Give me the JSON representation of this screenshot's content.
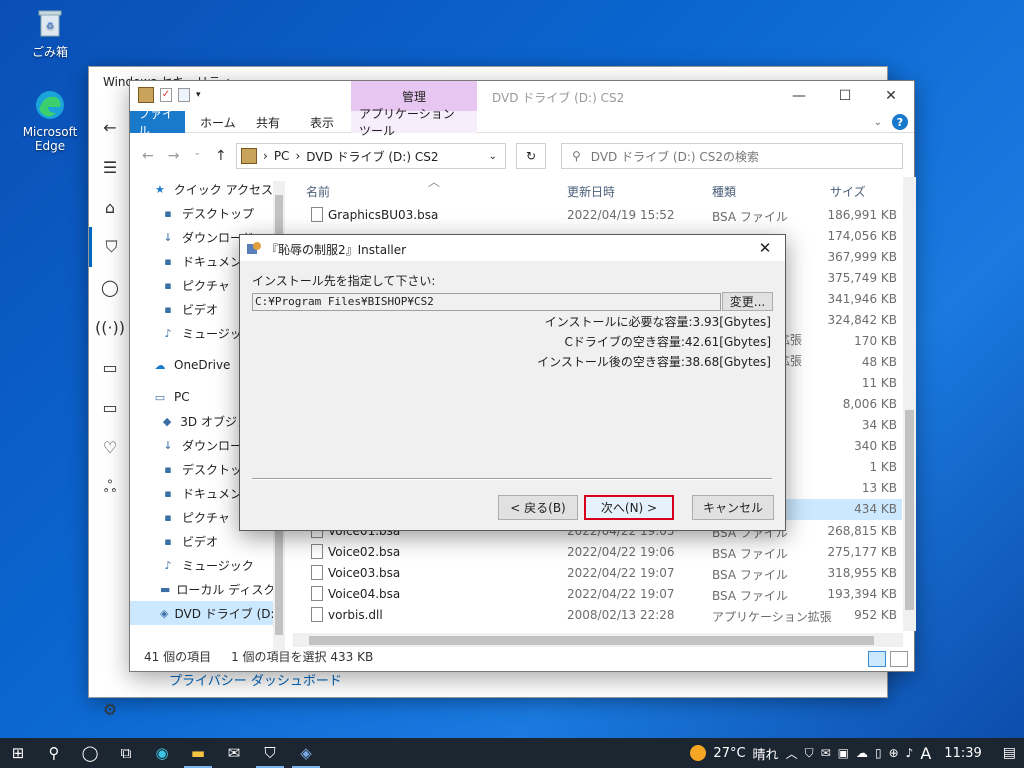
{
  "desktop": {
    "icons": [
      {
        "label": "ごみ箱"
      },
      {
        "label": "Microsoft Edge"
      }
    ]
  },
  "security_window": {
    "title": "Windows セキュリティ",
    "footer_link": "プライバシー ダッシュボード"
  },
  "explorer": {
    "manage_tab": "管理",
    "title": "DVD ドライブ (D:) CS2",
    "ribbon": {
      "file": "ファイル",
      "home": "ホーム",
      "share": "共有",
      "view": "表示",
      "app_tools": "アプリケーション ツール"
    },
    "address": {
      "crumb_pc": "PC",
      "crumb_drive": "DVD ドライブ (D:) CS2"
    },
    "search_placeholder": "DVD ドライブ (D:) CS2の検索",
    "nav": [
      {
        "label": "クイック アクセス",
        "icon": "star-icon",
        "indent": 22
      },
      {
        "label": "デスクトップ",
        "icon": "desktop-folder-icon",
        "indent": 30
      },
      {
        "label": "ダウンロード",
        "icon": "download-folder-icon",
        "indent": 30
      },
      {
        "label": "ドキュメント",
        "icon": "documents-folder-icon",
        "indent": 30
      },
      {
        "label": "ピクチャ",
        "icon": "pictures-folder-icon",
        "indent": 30
      },
      {
        "label": "ビデオ",
        "icon": "videos-folder-icon",
        "indent": 30
      },
      {
        "label": "ミュージック",
        "icon": "music-folder-icon",
        "indent": 30
      },
      {
        "label": "OneDrive",
        "icon": "onedrive-icon",
        "indent": 22
      },
      {
        "label": "PC",
        "icon": "pc-icon",
        "indent": 22
      },
      {
        "label": "3D オブジェクト",
        "icon": "3d-objects-icon",
        "indent": 30
      },
      {
        "label": "ダウンロード",
        "icon": "download-folder-icon",
        "indent": 30
      },
      {
        "label": "デスクトップ",
        "icon": "desktop-folder-icon",
        "indent": 30
      },
      {
        "label": "ドキュメント",
        "icon": "documents-folder-icon",
        "indent": 30
      },
      {
        "label": "ピクチャ",
        "icon": "pictures-folder-icon",
        "indent": 30
      },
      {
        "label": "ビデオ",
        "icon": "videos-folder-icon",
        "indent": 30
      },
      {
        "label": "ミュージック",
        "icon": "music-folder-icon",
        "indent": 30
      },
      {
        "label": "ローカル ディスク (C",
        "icon": "local-disk-icon",
        "indent": 30
      },
      {
        "label": "DVD ドライブ (D:)",
        "icon": "dvd-drive-icon",
        "indent": 30
      }
    ],
    "columns": {
      "name": "名前",
      "date": "更新日時",
      "type": "種類",
      "size": "サイズ"
    },
    "files_top": [
      {
        "name": "GraphicsBU03.bsa",
        "date": "2022/04/19 15:52",
        "type": "BSA ファイル",
        "size": "186,991 KB"
      }
    ],
    "size_column_visible": [
      "174,056 KB",
      "367,999 KB",
      "375,749 KB",
      "341,946 KB",
      "324,842 KB",
      "170 KB",
      "48 KB",
      "11 KB",
      "8,006 KB",
      "34 KB",
      "340 KB",
      "1 KB",
      "13 KB",
      "434 KB"
    ],
    "type_fragments": [
      "拡張",
      "拡張"
    ],
    "files_bottom": [
      {
        "name": "Voice01.bsa",
        "date": "2022/04/22 19:05",
        "type": "BSA ファイル",
        "size": "268,815 KB"
      },
      {
        "name": "Voice02.bsa",
        "date": "2022/04/22 19:06",
        "type": "BSA ファイル",
        "size": "275,177 KB"
      },
      {
        "name": "Voice03.bsa",
        "date": "2022/04/22 19:07",
        "type": "BSA ファイル",
        "size": "318,955 KB"
      },
      {
        "name": "Voice04.bsa",
        "date": "2022/04/22 19:07",
        "type": "BSA ファイル",
        "size": "193,394 KB"
      },
      {
        "name": "vorbis.dll",
        "date": "2008/02/13 22:28",
        "type": "アプリケーション拡張",
        "size": "952 KB"
      }
    ],
    "status": {
      "count": "41 個の項目",
      "selection": "1 個の項目を選択  433 KB"
    }
  },
  "installer": {
    "title": "『恥辱の制服2』Installer",
    "prompt": "インストール先を指定して下さい:",
    "path": "C:¥Program Files¥BISHOP¥CS2",
    "browse": "変更...",
    "required": "インストールに必要な容量:3.93[Gbytes]",
    "free_c": "Cドライブの空き容量:42.61[Gbytes]",
    "free_after": "インストール後の空き容量:38.68[Gbytes]",
    "back": "< 戻る(B)",
    "next": "次へ(N) >",
    "cancel": "キャンセル"
  },
  "taskbar": {
    "temperature": "27°C",
    "weather": "晴れ",
    "ime": "A",
    "time": "11:39"
  },
  "colors": {
    "accent": "#0067c0",
    "ribbon_file": "#1979ca",
    "manage_tab": "#e8c6f2",
    "highlight_border": "#d9001b",
    "selection": "#cce8ff"
  }
}
